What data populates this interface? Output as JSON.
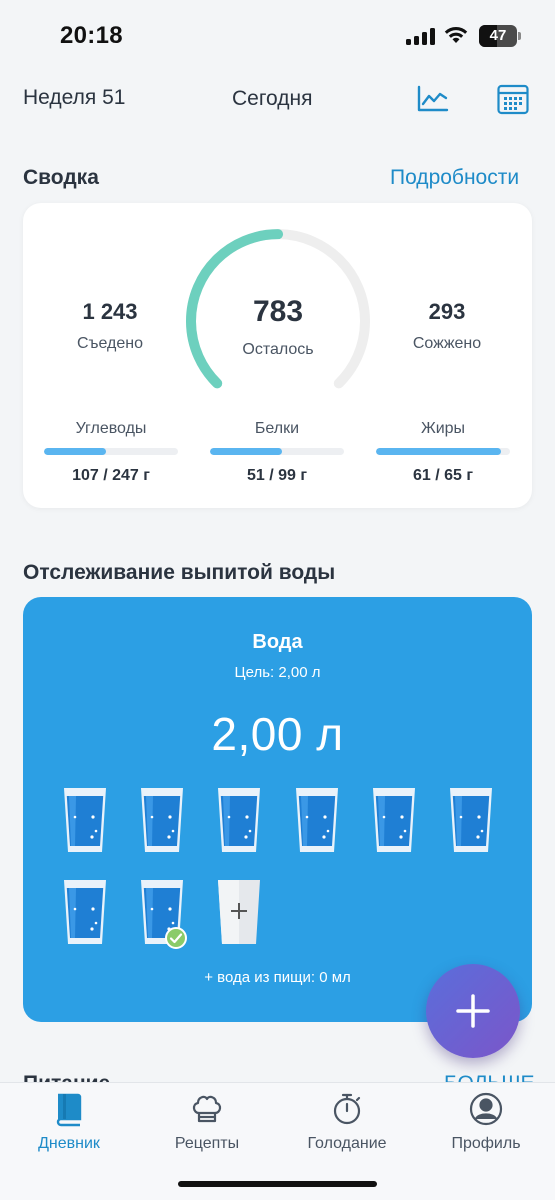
{
  "status": {
    "time": "20:18",
    "battery": "47"
  },
  "header": {
    "week": "Неделя 51",
    "today": "Сегодня"
  },
  "summary": {
    "title": "Сводка",
    "details": "Подробности",
    "eaten": {
      "value": "1 243",
      "label": "Съедено"
    },
    "remaining": {
      "value": "783",
      "label": "Осталось"
    },
    "burned": {
      "value": "293",
      "label": "Сожжено"
    },
    "gauge_progress": 0.5,
    "macros": [
      {
        "name": "Углеводы",
        "value": "107 / 247 г",
        "fraction": 0.46
      },
      {
        "name": "Белки",
        "value": "51 / 99 г",
        "fraction": 0.54
      },
      {
        "name": "Жиры",
        "value": "61 / 65 г",
        "fraction": 0.93
      }
    ]
  },
  "water": {
    "section_title": "Отслеживание выпитой воды",
    "title": "Вода",
    "goal": "Цель: 2,00 л",
    "amount": "2,00 л",
    "food_water": "+ вода из пищи: 0 мл",
    "glasses_filled": 8
  },
  "next_section": {
    "title": "Питание",
    "link": "БОЛЬШЕ"
  },
  "tabs": [
    {
      "label": "Дневник",
      "icon": "book-icon",
      "active": true
    },
    {
      "label": "Рецепты",
      "icon": "chef-hat-icon",
      "active": false
    },
    {
      "label": "Голодание",
      "icon": "stopwatch-icon",
      "active": false
    },
    {
      "label": "Профиль",
      "icon": "profile-icon",
      "active": false
    }
  ],
  "colors": {
    "accent": "#1E8BC8",
    "gauge": "#6DD0BE",
    "water_card": "#2C9FE4",
    "macro_fill": "#5AB5F0",
    "fab_start": "#5A6EDB",
    "fab_end": "#7B56C9"
  }
}
